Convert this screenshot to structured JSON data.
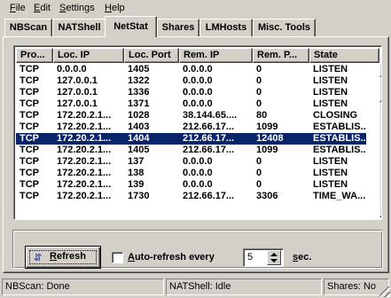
{
  "menu": [
    {
      "label": "File",
      "underline": "F",
      "rest": "ile"
    },
    {
      "label": "Edit",
      "underline": "E",
      "rest": "dit"
    },
    {
      "label": "Settings",
      "underline": "S",
      "rest": "ettings"
    },
    {
      "label": "Help",
      "underline": "H",
      "rest": "elp"
    }
  ],
  "tabs": [
    {
      "label": "NBScan"
    },
    {
      "label": "NATShell"
    },
    {
      "label": "NetStat",
      "active": true
    },
    {
      "label": "Shares"
    },
    {
      "label": "LMHosts"
    },
    {
      "label": "Misc. Tools"
    }
  ],
  "list": {
    "columns": [
      "Pro...",
      "Loc. IP",
      "Loc. Port",
      "Rem. IP",
      "Rem. P...",
      "State"
    ],
    "rows": [
      [
        "TCP",
        "0.0.0.0",
        "1405",
        "0.0.0.0",
        "0",
        "LISTEN"
      ],
      [
        "TCP",
        "127.0.0.1",
        "1322",
        "0.0.0.0",
        "0",
        "LISTEN"
      ],
      [
        "TCP",
        "127.0.0.1",
        "1336",
        "0.0.0.0",
        "0",
        "LISTEN"
      ],
      [
        "TCP",
        "127.0.0.1",
        "1371",
        "0.0.0.0",
        "0",
        "LISTEN"
      ],
      [
        "TCP",
        "172.20.2.1...",
        "1028",
        "38.144.65....",
        "80",
        "CLOSING"
      ],
      [
        "TCP",
        "172.20.2.1...",
        "1403",
        "212.66.17...",
        "1099",
        "ESTABLIS..."
      ],
      [
        "TCP",
        "172.20.2.1...",
        "1404",
        "212.66.17...",
        "12408",
        "ESTABLIS..."
      ],
      [
        "TCP",
        "172.20.2.1...",
        "1405",
        "212.66.17...",
        "1099",
        "ESTABLIS..."
      ],
      [
        "TCP",
        "172.20.2.1...",
        "137",
        "0.0.0.0",
        "0",
        "LISTEN"
      ],
      [
        "TCP",
        "172.20.2.1...",
        "138",
        "0.0.0.0",
        "0",
        "LISTEN"
      ],
      [
        "TCP",
        "172.20.2.1...",
        "139",
        "0.0.0.0",
        "0",
        "LISTEN"
      ],
      [
        "TCP",
        "172.20.2.1...",
        "1730",
        "212.66.17...",
        "3306",
        "TIME_WA..."
      ]
    ],
    "selected_row": 6
  },
  "controls": {
    "refresh_icon": "refresh-arrows-icon",
    "refresh_label_u": "R",
    "refresh_label_rest": "efresh",
    "auto_refresh_u": "A",
    "auto_refresh_rest": "uto-refresh every",
    "auto_refresh_checked": false,
    "interval_value": "5",
    "sec_u": "s",
    "sec_rest": "ec."
  },
  "status": {
    "nbscan": "NBScan: Done",
    "natshell": "NATShell: Idle",
    "shares": "Shares: No"
  }
}
